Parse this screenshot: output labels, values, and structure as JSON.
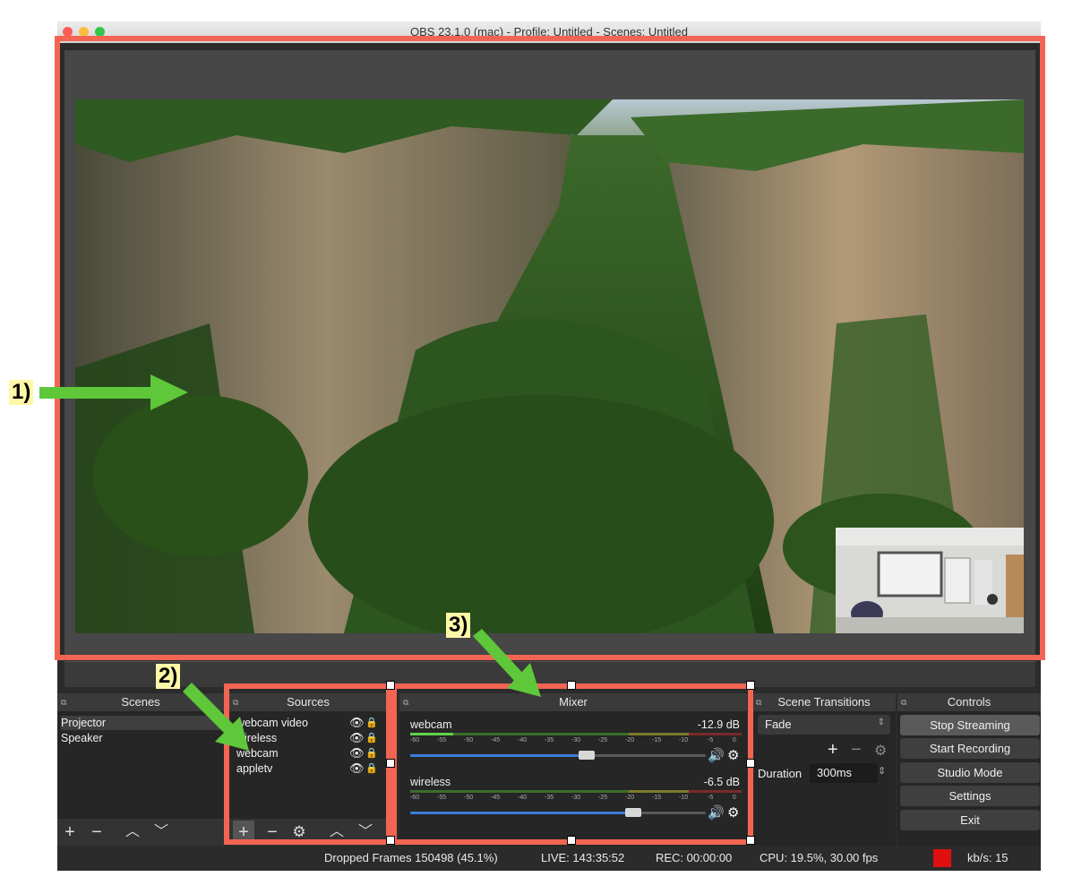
{
  "window": {
    "title": "OBS 23.1.0 (mac) - Profile: Untitled - Scenes: Untitled"
  },
  "scenes": {
    "header": "Scenes",
    "items": [
      "Projector",
      "Speaker"
    ]
  },
  "sources": {
    "header": "Sources",
    "items": [
      "webcam video",
      "wireless",
      "webcam",
      "appletv"
    ]
  },
  "mixer": {
    "header": "Mixer",
    "channels": [
      {
        "name": "webcam",
        "level": "-12.9 dB",
        "volume_fraction": 0.57
      },
      {
        "name": "wireless",
        "level": "-6.5 dB",
        "volume_fraction": 0.75
      }
    ],
    "ticks": [
      "-60",
      "-55",
      "-50",
      "-45",
      "-40",
      "-35",
      "-30",
      "-25",
      "-20",
      "-15",
      "-10",
      "-5",
      "0"
    ]
  },
  "transitions": {
    "header": "Scene Transitions",
    "selected": "Fade",
    "duration_label": "Duration",
    "duration_value": "300ms"
  },
  "controls": {
    "header": "Controls",
    "buttons": [
      "Stop Streaming",
      "Start Recording",
      "Studio Mode",
      "Settings",
      "Exit"
    ]
  },
  "status": {
    "dropped": "Dropped Frames 150498 (45.1%)",
    "live": "LIVE: 143:35:52",
    "rec": "REC: 00:00:00",
    "cpu": "CPU: 19.5%, 30.00 fps",
    "kbs": "kb/s: 15",
    "indicator_color": "#e01010"
  },
  "annotations": {
    "label1": "1)",
    "label2": "2)",
    "label3": "3)",
    "box_color": "#f26552",
    "arrow_color": "#5ec73a"
  }
}
